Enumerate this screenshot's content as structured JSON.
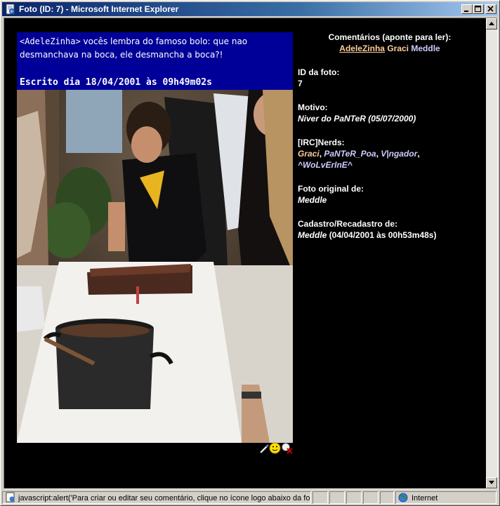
{
  "window": {
    "title": "Foto (ID: 7) - Microsoft Internet Explorer"
  },
  "comment": {
    "author": "<AdeleZinha>",
    "text": " vocês lembra do famoso bolo: que nao desmanchava na boca, ele desmancha a boca?!",
    "date": "Escrito dia 18/04/2001 às 09h49m02s"
  },
  "sidebar": {
    "comments_heading": "Comentários (aponte para ler):",
    "commenters": [
      "AdeleZinha",
      "Graci",
      "Meddle"
    ],
    "photo_id_label": "ID da foto:",
    "photo_id": "7",
    "motive_label": "Motivo:",
    "motive": "Niver do PaNTeR (05/07/2000)",
    "nerds_label": "[IRC]Nerds:",
    "nerds": [
      "Graci",
      "PaNTeR_Poa",
      "V|ngador",
      "^WoLvErInE^"
    ],
    "original_label": "Foto original de:",
    "original": "Meddle",
    "register_label": "Cadastro/Recadastro de:",
    "register_name": "Meddle",
    "register_date": "(04/04/2001 às 00h53m48s)"
  },
  "status": {
    "text": "javascript:alert('Para criar ou editar seu comentário, clique no ícone logo abaixo da foto!",
    "zone": "Internet"
  },
  "icons": [
    "ie-page-icon",
    "minimize-icon",
    "maximize-icon",
    "close-icon",
    "edit-comment-icon",
    "smiley-icon",
    "delete-comment-icon",
    "globe-icon"
  ],
  "colors": {
    "titlebar_start": "#0a246a",
    "comment_bg": "#000099",
    "page_bg": "#000000",
    "link_orange": "#ffcc99",
    "link_blue": "#ccccff"
  }
}
